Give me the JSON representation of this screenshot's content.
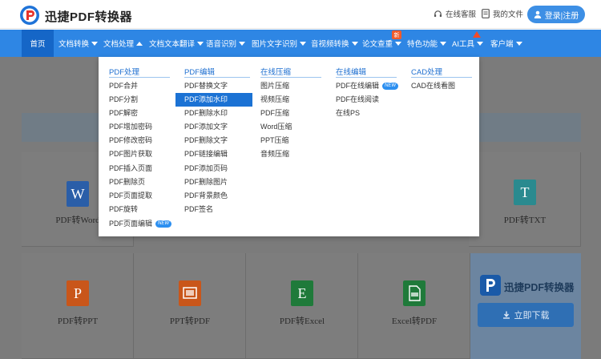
{
  "header": {
    "brand": "迅捷PDF转换器",
    "service_label": "在线客服",
    "files_label": "我的文件",
    "login_label": "登录|注册"
  },
  "nav": {
    "items": [
      {
        "label": "首页"
      },
      {
        "label": "文档转换"
      },
      {
        "label": "文档处理"
      },
      {
        "label": "文档文本翻译"
      },
      {
        "label": "语音识别"
      },
      {
        "label": "图片文字识别"
      },
      {
        "label": "音视频转换"
      },
      {
        "label": "论文查重"
      },
      {
        "label": "特色功能"
      },
      {
        "label": "AI工具"
      },
      {
        "label": "客户端"
      }
    ],
    "new_badge": "新"
  },
  "dropdown": {
    "columns": [
      {
        "title": "PDF处理",
        "items": [
          "PDF合并",
          "PDF分割",
          "PDF解密",
          "PDF增加密码",
          "PDF修改密码",
          "PDF图片获取",
          "PDF插入页面",
          "PDF删除页",
          "PDF页面提取",
          "PDF旋转",
          "PDF页面编辑"
        ]
      },
      {
        "title": "PDF编辑",
        "items": [
          "PDF替换文字",
          "PDF添加水印",
          "PDF删除水印",
          "PDF添加文字",
          "PDF删除文字",
          "PDF链接编辑",
          "PDF添加页码",
          "PDF删除图片",
          "PDF背景颜色",
          "PDF签名"
        ]
      },
      {
        "title": "在线压缩",
        "items": [
          "图片压缩",
          "视频压缩",
          "PDF压缩",
          "Word压缩",
          "PPT压缩",
          "音频压缩"
        ]
      },
      {
        "title": "在线编辑",
        "items": [
          "PDF在线编辑",
          "PDF在线阅读",
          "在线PS"
        ]
      },
      {
        "title": "CAD处理",
        "items": [
          "CAD在线看图"
        ]
      }
    ],
    "new_tag": "NEW"
  },
  "tools": {
    "row1": [
      {
        "label": "PDF转Word",
        "icon": "W"
      },
      {
        "label": "PDF转TXT",
        "icon": "T"
      }
    ],
    "row2": [
      {
        "label": "PDF转PPT",
        "icon": "P"
      },
      {
        "label": "PPT转PDF",
        "icon": "ppt-to-pdf-icon"
      },
      {
        "label": "PDF转Excel",
        "icon": "E"
      },
      {
        "label": "Excel转PDF",
        "icon": "excel-to-pdf-icon"
      }
    ]
  },
  "promo": {
    "brand": "迅捷PDF转换器",
    "download_label": "立即下载"
  },
  "colors": {
    "nav_blue": "#2e86e4",
    "nav_active": "#1566c7",
    "accent": "#1b72d4",
    "word_blue": "#2a5ea8",
    "txt_teal": "#2a8a8f",
    "ppt_orange": "#c9561a",
    "excel_green": "#1f7a3a"
  }
}
